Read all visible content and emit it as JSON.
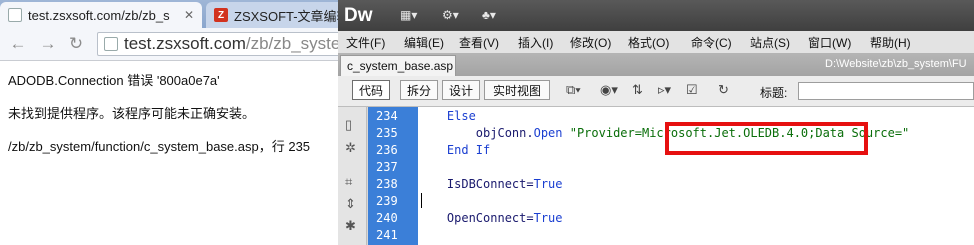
{
  "browser": {
    "tabs": [
      {
        "title": "test.zsxsoft.com/zb/zb_s",
        "active": true
      },
      {
        "title": "ZSXSOFT-文章编辑",
        "active": false
      }
    ],
    "url": {
      "host": "test.zsxsoft.com",
      "path": "/zb/zb_system"
    },
    "page_lines": [
      "ADODB.Connection  错误 '800a0e7a'",
      "未找到提供程序。该程序可能未正确安装。",
      "/zb/zb_system/function/c_system_base.asp，行 235"
    ]
  },
  "dreamweaver": {
    "logo": "Dw",
    "menu": [
      "文件(F)",
      "编辑(E)",
      "查看(V)",
      "插入(I)",
      "修改(O)",
      "格式(O)",
      "命令(C)",
      "站点(S)",
      "窗口(W)",
      "帮助(H)"
    ],
    "doc_tab": "c_system_base.asp",
    "doc_path": "D:\\Website\\zb\\zb_system\\FU",
    "views": [
      "代码",
      "拆分",
      "设计",
      "实时视图"
    ],
    "title_label": "标题:",
    "lines": [
      {
        "no": "234",
        "tokens": [
          {
            "t": "    ",
            "c": ""
          },
          {
            "t": "Else",
            "c": "kw"
          }
        ]
      },
      {
        "no": "235",
        "tokens": [
          {
            "t": "        objConn.",
            "c": "obj"
          },
          {
            "t": "Open",
            "c": "kw"
          },
          {
            "t": " \"Provider=Microsoft.Jet.OLEDB.4.0;Data Source=\"",
            "c": "str"
          }
        ]
      },
      {
        "no": "236",
        "tokens": [
          {
            "t": "    ",
            "c": ""
          },
          {
            "t": "End If",
            "c": "kw"
          }
        ]
      },
      {
        "no": "237",
        "tokens": []
      },
      {
        "no": "238",
        "tokens": [
          {
            "t": "    IsDBConnect=",
            "c": "obj"
          },
          {
            "t": "True",
            "c": "kw"
          }
        ]
      },
      {
        "no": "239",
        "tokens": []
      },
      {
        "no": "240",
        "tokens": [
          {
            "t": "    OpenConnect=",
            "c": "obj"
          },
          {
            "t": "True",
            "c": "kw"
          }
        ]
      },
      {
        "no": "241",
        "tokens": []
      }
    ]
  },
  "colors": {
    "gutter": "#3b7fd8",
    "highlight_box": "#e61010",
    "keyword": "#1b3fd1",
    "string": "#0a6e0a"
  }
}
